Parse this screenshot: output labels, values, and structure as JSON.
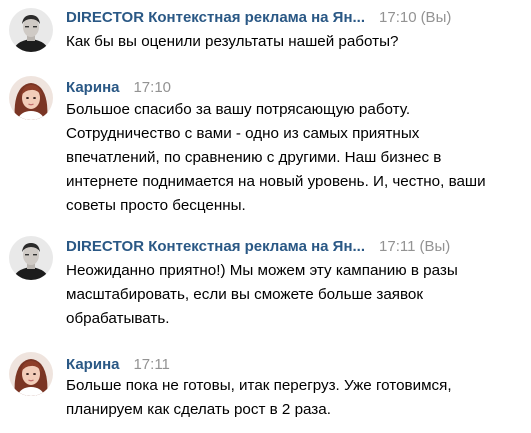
{
  "messages": [
    {
      "author": "DIRECTOR Контекстная реклама на Ян...",
      "time": "17:10",
      "suffix": "(Вы)",
      "avatar_icon": "man-avatar-icon",
      "text": "Как бы вы оценили результаты нашей работы?"
    },
    {
      "author": "Карина",
      "time": "17:10",
      "avatar_icon": "woman-avatar-icon",
      "text": "Большое спасибо за вашу потрясающую работу.\nСотрудничество с вами - одно из самых приятных\nвпечатлений, по сравнению с другими. Наш бизнес в\nинтернете поднимается на новый уровень. И, честно, ваши\nсоветы просто бесценны."
    },
    {
      "author": "DIRECTOR Контекстная реклама на Ян...",
      "time": "17:11",
      "suffix": "(Вы)",
      "avatar_icon": "man-avatar-icon",
      "text": "Неожиданно приятно!) Мы можем эту кампанию в разы\nмасштабировать, если вы сможете больше заявок\nобрабатывать."
    },
    {
      "author": "Карина",
      "time": "17:11",
      "avatar_icon": "woman-avatar-icon",
      "text": "Больше пока не готовы, итак перегруз. Уже готовимся,\nпланируем как сделать рост в 2 раза."
    }
  ],
  "colors": {
    "author": "#2a5885",
    "time": "#939393",
    "text": "#000000"
  }
}
